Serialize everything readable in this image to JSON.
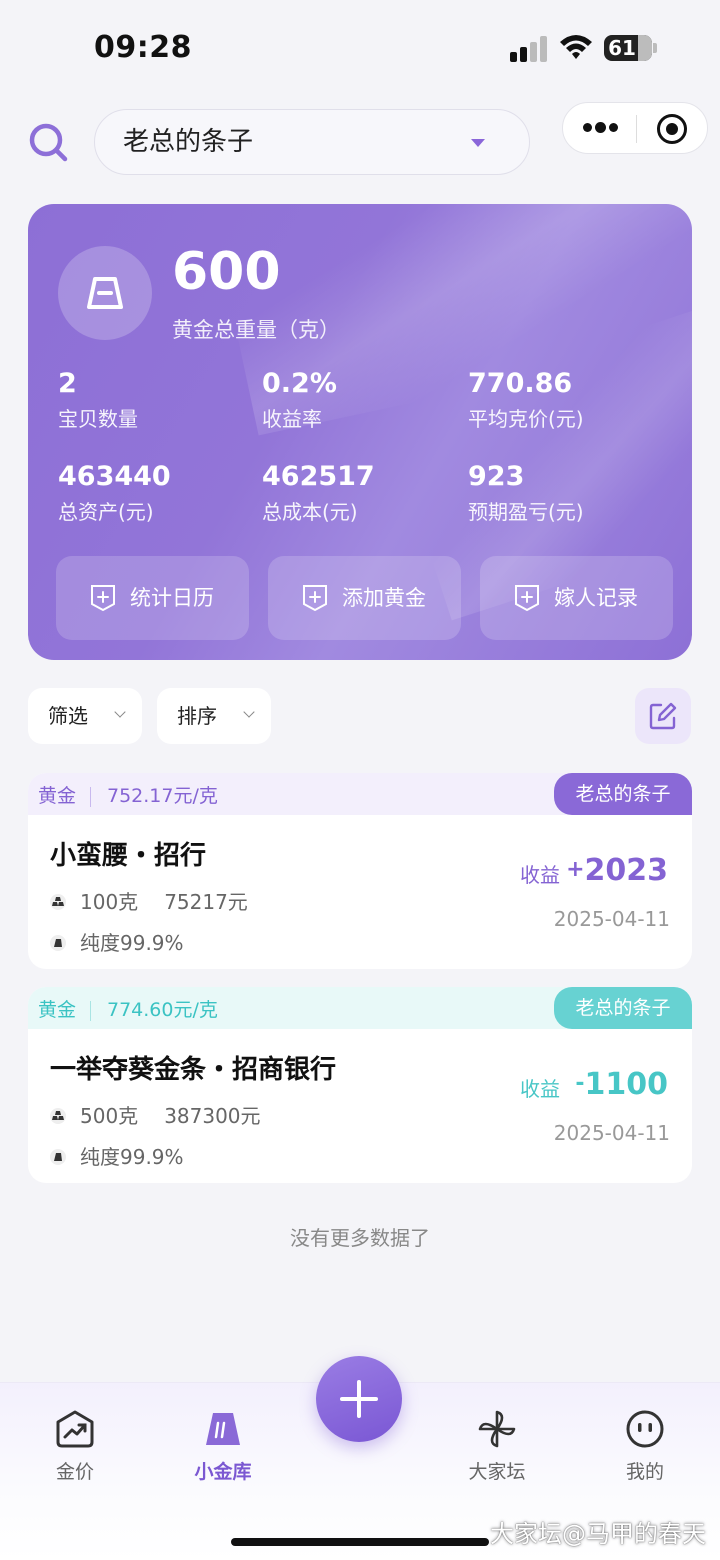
{
  "status_bar": {
    "time": "09:28",
    "battery": "61"
  },
  "header": {
    "vault_name": "老总的条子"
  },
  "summary": {
    "total_weight": "600",
    "total_weight_label": "黄金总重量（克）",
    "stats": [
      {
        "value": "2",
        "label": "宝贝数量"
      },
      {
        "value": "0.2%",
        "label": "收益率"
      },
      {
        "value": "770.86",
        "label": "平均克价(元)"
      },
      {
        "value": "463440",
        "label": "总资产(元)"
      },
      {
        "value": "462517",
        "label": "总成本(元)"
      },
      {
        "value": "923",
        "label": "预期盈亏(元)"
      }
    ],
    "actions": [
      {
        "label": "统计日历"
      },
      {
        "label": "添加黄金"
      },
      {
        "label": "嫁人记录"
      }
    ]
  },
  "filters": {
    "filter_label": "筛选",
    "sort_label": "排序"
  },
  "items": [
    {
      "type": "黄金",
      "unit_price": "752.17元/克",
      "tag": "老总的条子",
      "name": "小蛮腰・招行",
      "weight": "100克",
      "cost": "75217元",
      "purity": "纯度99.9%",
      "profit_label": "收益",
      "profit_sign": "+",
      "profit_value": "2023",
      "date": "2025-04-11",
      "accent": "#8463d3"
    },
    {
      "type": "黄金",
      "unit_price": "774.60元/克",
      "tag": "老总的条子",
      "name": "一举夺葵金条・招商银行",
      "weight": "500克",
      "cost": "387300元",
      "purity": "纯度99.9%",
      "profit_label": "收益",
      "profit_sign": "-",
      "profit_value": "1100",
      "date": "2025-04-11",
      "accent": "#47c6c6"
    }
  ],
  "list_end": "没有更多数据了",
  "tabbar": {
    "tabs": [
      {
        "label": "金价",
        "icon": "trend-chart-icon"
      },
      {
        "label": "小金库",
        "icon": "gold-bar-icon",
        "active": true
      },
      {
        "label": "大家坛",
        "icon": "pinwheel-icon"
      },
      {
        "label": "我的",
        "icon": "face-icon"
      }
    ]
  },
  "watermark": "大家坛@马甲的春天"
}
